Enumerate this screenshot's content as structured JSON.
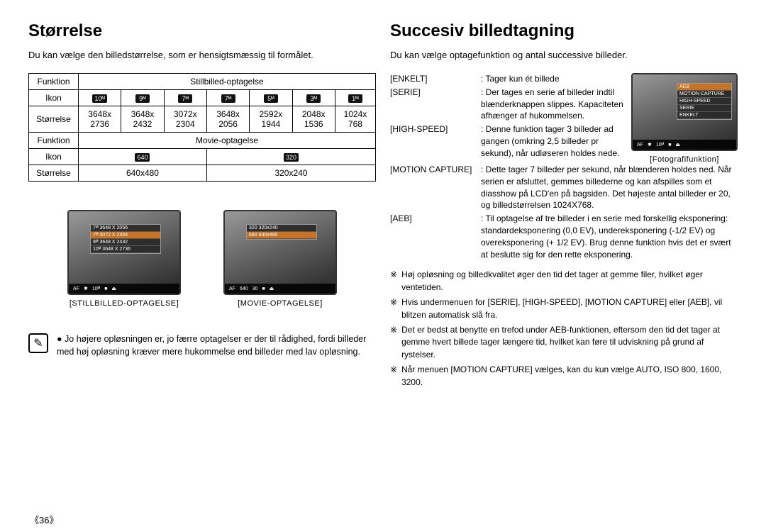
{
  "left": {
    "title": "Størrelse",
    "intro": "Du kan vælge den billedstørrelse, som er hensigtsmæssig til formålet.",
    "tbl": {
      "r_funktion": "Funktion",
      "r_ikon": "Ikon",
      "r_storrelse": "Størrelse",
      "still_header": "Stillbilled-optagelse",
      "movie_header": "Movie-optagelse",
      "icons": [
        "10ᴹ",
        "9ᴹ",
        "7ᴹ",
        "7ᴹ",
        "5ᴹ",
        "3ᴹ",
        "1ᴹ"
      ],
      "dims": [
        "3648x 2736",
        "3648x 2432",
        "3072x 2304",
        "3648x 2056",
        "2592x 1944",
        "2048x 1536",
        "1024x 768"
      ],
      "movie_icons": [
        "640",
        "320"
      ],
      "movie_dims": [
        "640x480",
        "320x240"
      ]
    },
    "thumbs": {
      "still": {
        "caption": "[STILLBILLED-OPTAGELSE]",
        "menu": [
          "7ᴹ   3648 X 2056",
          "7ᴹ   3072 X 2304",
          "9ᴹ   3648 X 2432",
          "10ᴹ  3648 X 2736"
        ],
        "status": [
          "AF",
          "✱",
          "10ᴹ",
          "■",
          "⏏"
        ]
      },
      "movie": {
        "caption": "[MOVIE-OPTAGELSE]",
        "menu": [
          "320   320x240",
          "640   640x480"
        ],
        "status": [
          "AF",
          "640",
          "30",
          "■",
          "⏏"
        ]
      }
    },
    "note": "Jo højere opløsningen er, jo færre optagelser er der til rådighed, fordi billeder med høj opløsning kræver mere hukommelse end billeder med lav opløsning.",
    "page_number": "《36》"
  },
  "right": {
    "title": "Succesiv billedtagning",
    "intro": "Du kan vælge optagefunktion og antal successive billeder.",
    "defs": {
      "enkelt": {
        "term": "[ENKELT]",
        "desc": ": Tager kun ét billede"
      },
      "serie": {
        "term": "[SERIE]",
        "desc": ": Der tages en serie af billeder indtil blænderknappen slippes. Kapaciteten afhænger af hukommelsen."
      },
      "highspeed": {
        "term": "[HIGH-SPEED]",
        "desc": ": Denne funktion tager 3 billeder ad gangen (omkring 2,5 billeder pr sekund), når udløseren holdes nede."
      },
      "motion": {
        "term": "[MOTION CAPTURE]",
        "desc": ": Dette tager 7 billeder per sekund, når blænderen holdes ned. Når serien er afsluttet, gemmes billederne og kan afspilles som et diasshow på LCD'en på bagsiden. Det højeste antal billeder er 20, og billedstørrelsen 1024X768."
      },
      "aeb": {
        "term": "[AEB]",
        "desc": ": Til optagelse af tre billeder i en serie med forskellig eksponering: standardeksponering (0,0 EV), undereksponering (-1/2 EV) og overeksponering (+ 1/2 EV). Brug denne funktion hvis det er svært at beslutte sig for den rette eksponering."
      }
    },
    "float_thumb": {
      "caption": "[Fotografifunktion]",
      "menu": [
        "AEB",
        "MOTION CAPTURE",
        "HIGH-SPEED",
        "SERIE",
        "ENKELT"
      ],
      "status": [
        "AF",
        "✱",
        "10ᴹ",
        "■",
        "⏏"
      ]
    },
    "bullets": {
      "b1": "Høj opløsning og billedkvalitet øger den tid det tager at gemme filer, hvilket øger ventetiden.",
      "b2": "Hvis undermenuen for [SERIE], [HIGH-SPEED], [MOTION CAPTURE] eller [AEB], vil blitzen automatisk slå fra.",
      "b3": "Det er bedst at benytte en trefod under AEB-funktionen, eftersom den tid det tager at gemme hvert billede tager længere tid, hvilket kan føre til udviskning på grund af rystelser.",
      "b4": "Når menuen [MOTION CAPTURE] vælges, kan du kun vælge AUTO, ISO 800, 1600, 3200."
    }
  }
}
